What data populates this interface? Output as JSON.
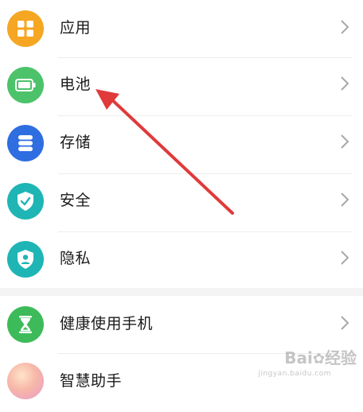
{
  "settings": {
    "items": [
      {
        "label": "应用",
        "icon": "grid-icon",
        "color": "#f5a623"
      },
      {
        "label": "电池",
        "icon": "battery-icon",
        "color": "#4cc36a"
      },
      {
        "label": "存储",
        "icon": "storage-icon",
        "color": "#2f6ee0"
      },
      {
        "label": "安全",
        "icon": "shield-check-icon",
        "color": "#1fb5b5"
      },
      {
        "label": "隐私",
        "icon": "privacy-shield-icon",
        "color": "#1fb5b5"
      }
    ],
    "items2": [
      {
        "label": "健康使用手机",
        "icon": "hourglass-icon",
        "color": "#3dbb5a"
      },
      {
        "label": "智慧助手",
        "icon": "assistant-icon",
        "color": "#f0a5a0"
      }
    ]
  },
  "annotation": {
    "arrow_color": "#e03a3a"
  },
  "watermark": {
    "text": "Bai",
    "text2": "经验",
    "sub": "jingyan.baidu.com"
  }
}
